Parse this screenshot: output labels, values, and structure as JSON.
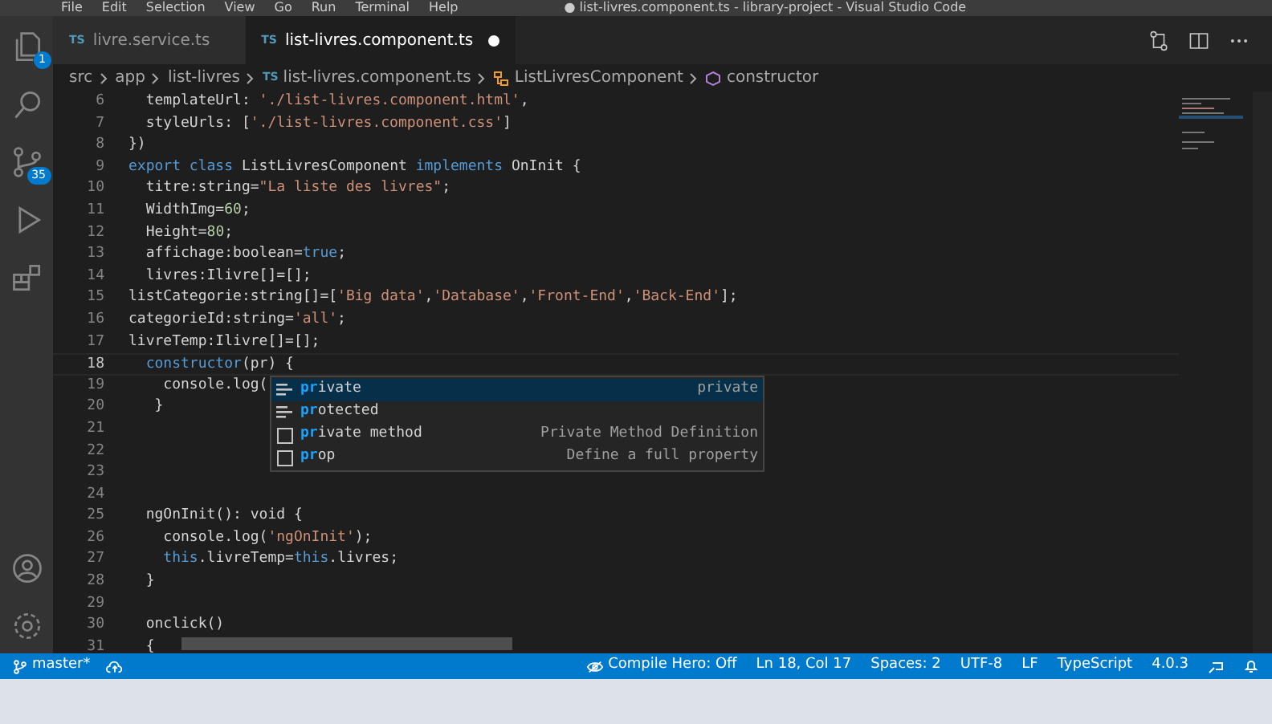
{
  "menu": [
    "File",
    "Edit",
    "Selection",
    "View",
    "Go",
    "Run",
    "Terminal",
    "Help"
  ],
  "window": {
    "title": "● list-livres.component.ts - library-project - Visual Studio Code"
  },
  "activity_bar": [
    {
      "kind": "files",
      "badge": "1"
    },
    {
      "kind": "search"
    },
    {
      "kind": "source-control",
      "badge": "35"
    },
    {
      "kind": "debug"
    },
    {
      "kind": "extensions"
    },
    {
      "kind": "account"
    },
    {
      "kind": "settings"
    }
  ],
  "tabs": [
    {
      "lang": "TS",
      "label": "livre.service.ts",
      "selected": false,
      "modified": false
    },
    {
      "lang": "TS",
      "label": "list-livres.component.ts",
      "selected": true,
      "modified": true
    }
  ],
  "breadcrumb": [
    "src",
    "app",
    "list-livres",
    {
      "lang": "TS",
      "label": "list-livres.component.ts"
    },
    "ListLivresComponent",
    "constructor"
  ],
  "code": [
    {
      "n": "6",
      "tokens": [
        {
          "kind": "plain",
          "t": "  templateUrl: "
        },
        {
          "kind": "string",
          "t": "'./list-livres.component.html'"
        },
        {
          "kind": "plain",
          "t": ","
        }
      ]
    },
    {
      "n": "7",
      "tokens": [
        {
          "kind": "plain",
          "t": "  styleUrls: ["
        },
        {
          "kind": "string",
          "t": "'./list-livres.component.css'"
        },
        {
          "kind": "plain",
          "t": "]"
        }
      ]
    },
    {
      "n": "8",
      "tokens": [
        {
          "kind": "plain",
          "t": "})"
        }
      ]
    },
    {
      "n": "9",
      "tokens": [
        {
          "kind": "keyword",
          "t": "export class "
        },
        {
          "kind": "plain",
          "t": "ListLivresComponent "
        },
        {
          "kind": "keyword",
          "t": "implements "
        },
        {
          "kind": "plain",
          "t": "OnInit {"
        }
      ]
    },
    {
      "n": "10",
      "tokens": [
        {
          "kind": "plain",
          "t": "  titre:string="
        },
        {
          "kind": "string",
          "t": "\"La liste des livres\""
        },
        {
          "kind": "plain",
          "t": ";"
        }
      ]
    },
    {
      "n": "11",
      "tokens": [
        {
          "kind": "plain",
          "t": "  WidthImg="
        },
        {
          "kind": "number",
          "t": "60"
        },
        {
          "kind": "plain",
          "t": ";"
        }
      ]
    },
    {
      "n": "12",
      "tokens": [
        {
          "kind": "plain",
          "t": "  Height="
        },
        {
          "kind": "number",
          "t": "80"
        },
        {
          "kind": "plain",
          "t": ";"
        }
      ]
    },
    {
      "n": "13",
      "tokens": [
        {
          "kind": "plain",
          "t": "  affichage:boolean="
        },
        {
          "kind": "keyword",
          "t": "true"
        },
        {
          "kind": "plain",
          "t": ";"
        }
      ]
    },
    {
      "n": "14",
      "tokens": [
        {
          "kind": "plain",
          "t": "  livres:Ilivre[]=[];"
        }
      ]
    },
    {
      "n": "15",
      "tokens": [
        {
          "kind": "plain",
          "t": "listCategorie:string[]=["
        },
        {
          "kind": "string",
          "t": "'Big data'"
        },
        {
          "kind": "plain",
          "t": ","
        },
        {
          "kind": "string",
          "t": "'Database'"
        },
        {
          "kind": "plain",
          "t": ","
        },
        {
          "kind": "string",
          "t": "'Front-End'"
        },
        {
          "kind": "plain",
          "t": ","
        },
        {
          "kind": "string",
          "t": "'Back-End'"
        },
        {
          "kind": "plain",
          "t": "];"
        }
      ]
    },
    {
      "n": "16",
      "tokens": [
        {
          "kind": "plain",
          "t": "categorieId:string="
        },
        {
          "kind": "string",
          "t": "'all'"
        },
        {
          "kind": "plain",
          "t": ";"
        }
      ]
    },
    {
      "n": "17",
      "tokens": [
        {
          "kind": "plain",
          "t": "livreTemp:Ilivre[]=[];"
        }
      ]
    },
    {
      "n": "18",
      "current": true,
      "tokens": [
        {
          "kind": "keyword",
          "t": "  constructor"
        },
        {
          "kind": "plain",
          "t": "(pr) {"
        }
      ]
    },
    {
      "n": "19",
      "tokens": [
        {
          "kind": "plain",
          "t": "    console.log("
        }
      ]
    },
    {
      "n": "20",
      "tokens": [
        {
          "kind": "plain",
          "t": "   }"
        }
      ]
    },
    {
      "n": "21"
    },
    {
      "n": "22"
    },
    {
      "n": "23"
    },
    {
      "n": "24"
    },
    {
      "n": "25",
      "tokens": [
        {
          "kind": "plain",
          "t": "  ngOnInit(): void {"
        }
      ]
    },
    {
      "n": "26",
      "tokens": [
        {
          "kind": "plain",
          "t": "    console.log("
        },
        {
          "kind": "string",
          "t": "'ngOnInit'"
        },
        {
          "kind": "plain",
          "t": ");"
        }
      ]
    },
    {
      "n": "27",
      "tokens": [
        {
          "kind": "keyword",
          "t": "    this"
        },
        {
          "kind": "plain",
          "t": ".livreTemp="
        },
        {
          "kind": "keyword",
          "t": "this"
        },
        {
          "kind": "plain",
          "t": ".livres;"
        }
      ]
    },
    {
      "n": "28",
      "tokens": [
        {
          "kind": "plain",
          "t": "  }"
        }
      ]
    },
    {
      "n": "29"
    },
    {
      "n": "30",
      "tokens": [
        {
          "kind": "plain",
          "t": "  onclick()"
        }
      ]
    },
    {
      "n": "31",
      "tokens": [
        {
          "kind": "plain",
          "t": "  {"
        }
      ]
    }
  ],
  "suggestions": [
    {
      "kind": "keyword",
      "match": "pr",
      "rest": "ivate",
      "detail": "private",
      "selected": true
    },
    {
      "kind": "keyword",
      "match": "pr",
      "rest": "otected",
      "selected": false
    },
    {
      "kind": "snippet",
      "match": "pr",
      "rest": "ivate method",
      "detail": "Private Method Definition",
      "selected": false
    },
    {
      "kind": "snippet",
      "match": "pr",
      "rest": "op",
      "detail": "Define a full property",
      "selected": false
    }
  ],
  "status_bar": {
    "branch": "master*",
    "items": [
      "Compile Hero: Off",
      "Ln 18, Col 17",
      "Spaces: 2",
      "UTF-8",
      "LF",
      "TypeScript",
      "4.0.3"
    ]
  }
}
